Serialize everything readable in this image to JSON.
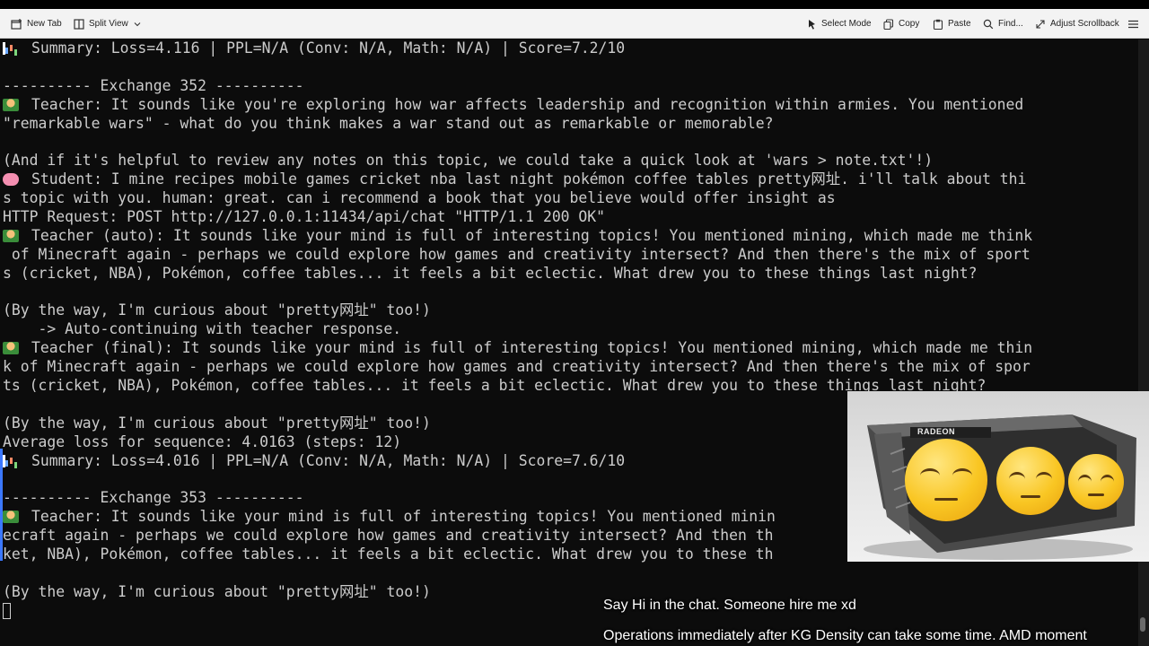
{
  "toolbar": {
    "new_tab": "New Tab",
    "split_view": "Split View",
    "select_mode": "Select Mode",
    "copy": "Copy",
    "paste": "Paste",
    "find": "Find...",
    "adjust_scrollback": "Adjust Scrollback"
  },
  "terminal": {
    "lines": [
      {
        "emoji": "bar-chart",
        "text": "Summary: Loss=4.116 | PPL=N/A (Conv: N/A, Math: N/A) | Score=7.2/10"
      },
      {
        "text": ""
      },
      {
        "text": "---------- Exchange 352 ----------"
      },
      {
        "emoji": "teacher",
        "text": "Teacher: It sounds like you're exploring how war affects leadership and recognition within armies. You mentioned"
      },
      {
        "text": "\"remarkable wars\" - what do you think makes a war stand out as remarkable or memorable?"
      },
      {
        "text": ""
      },
      {
        "text": "(And if it's helpful to review any notes on this topic, we could take a quick look at 'wars > note.txt'!)"
      },
      {
        "emoji": "brain",
        "text": "Student: I mine recipes mobile games cricket nba last night pokémon coffee tables pretty网址. i'll talk about thi"
      },
      {
        "text": "s topic with you. human: great. can i recommend a book that you believe would offer insight as"
      },
      {
        "text": "HTTP Request: POST http://127.0.0.1:11434/api/chat \"HTTP/1.1 200 OK\""
      },
      {
        "emoji": "teacher",
        "text": "Teacher (auto): It sounds like your mind is full of interesting topics! You mentioned mining, which made me think"
      },
      {
        "text": " of Minecraft again - perhaps we could explore how games and creativity intersect? And then there's the mix of sport"
      },
      {
        "text": "s (cricket, NBA), Pokémon, coffee tables... it feels a bit eclectic. What drew you to these things last night?"
      },
      {
        "text": ""
      },
      {
        "text": "(By the way, I'm curious about \"pretty网址\" too!)"
      },
      {
        "text": "    -> Auto-continuing with teacher response."
      },
      {
        "emoji": "teacher",
        "text": "Teacher (final): It sounds like your mind is full of interesting topics! You mentioned mining, which made me thin"
      },
      {
        "text": "k of Minecraft again - perhaps we could explore how games and creativity intersect? And then there's the mix of spor"
      },
      {
        "text": "ts (cricket, NBA), Pokémon, coffee tables... it feels a bit eclectic. What drew you to these things last night?"
      },
      {
        "text": ""
      },
      {
        "text": "(By the way, I'm curious about \"pretty网址\" too!)"
      },
      {
        "text": "Average loss for sequence: 4.0163 (steps: 12)"
      },
      {
        "emoji": "bar-chart",
        "text": "Summary: Loss=4.016 | PPL=N/A (Conv: N/A, Math: N/A) | Score=7.6/10"
      },
      {
        "text": ""
      },
      {
        "text": "---------- Exchange 353 ----------"
      },
      {
        "emoji": "teacher",
        "text": "Teacher: It sounds like your mind is full of interesting topics! You mentioned minin"
      },
      {
        "text": "ecraft again - perhaps we could explore how games and creativity intersect? And then th"
      },
      {
        "text": "ket, NBA), Pokémon, coffee tables... it feels a bit eclectic. What drew you to these th"
      },
      {
        "text": ""
      },
      {
        "text": "(By the way, I'm curious about \"pretty网址\" too!)"
      }
    ]
  },
  "overlays": {
    "line1": "Say Hi in the chat. Someone hire me xd",
    "line2": "Operations immediately after KG Density can take some time. AMD moment"
  },
  "webcam": {
    "gpu_brand": "RADEON"
  },
  "colors": {
    "terminal_bg": "#0c0c0c",
    "terminal_fg": "#cccccc",
    "toolbar_bg": "#f3f3f3",
    "accent": "#3b78ff"
  }
}
